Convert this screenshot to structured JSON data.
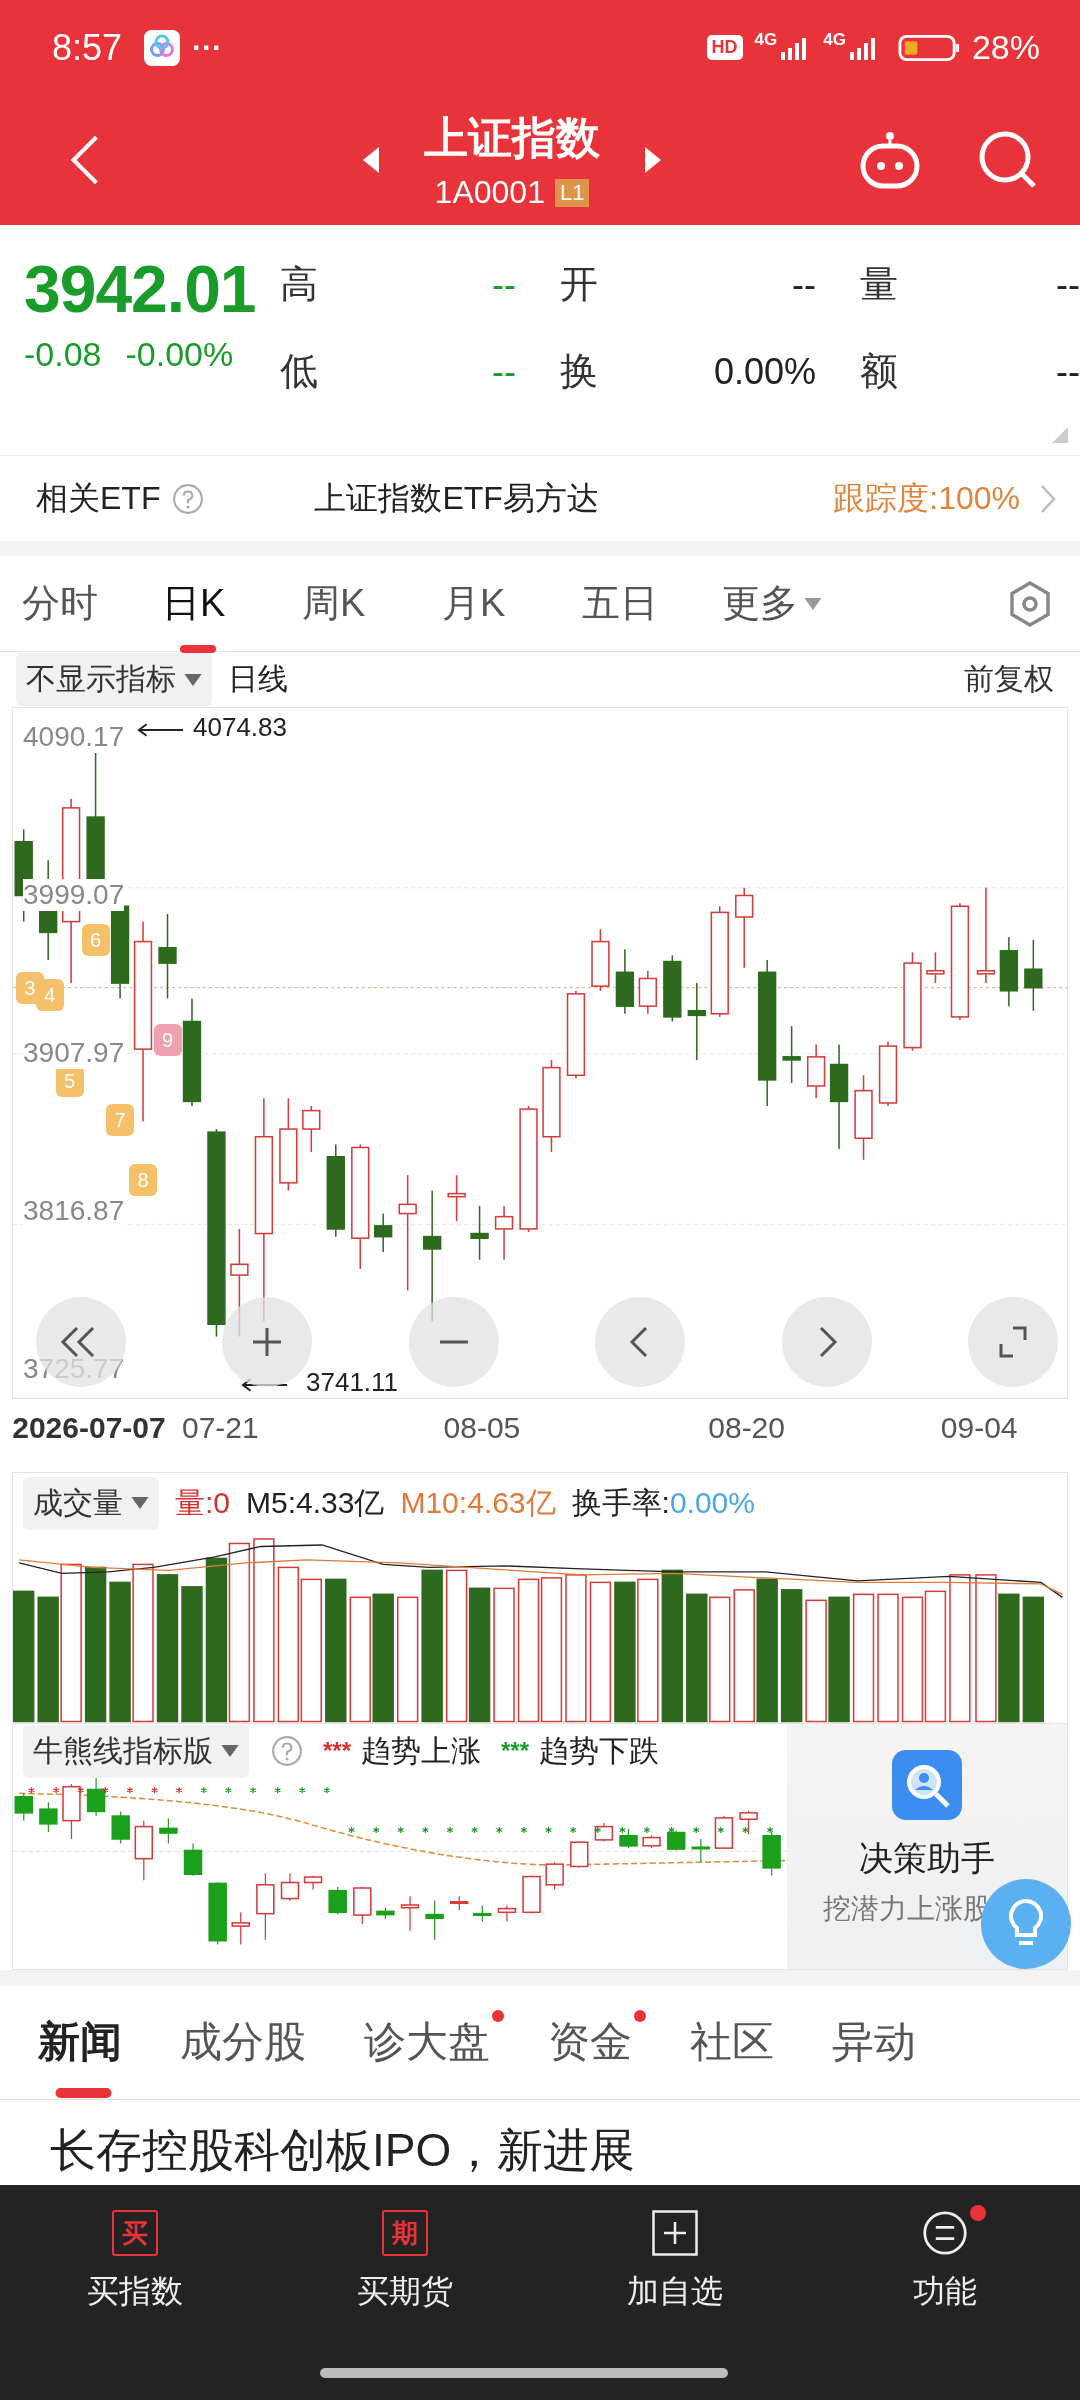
{
  "status_bar": {
    "time": "8:57",
    "more": "···",
    "hd": "HD",
    "network_1": "4G",
    "network_2": "4G",
    "battery": "28%"
  },
  "header": {
    "title": "上证指数",
    "code": "1A0001",
    "level_badge": "L1"
  },
  "quote": {
    "price": "3942.01",
    "change": "-0.08",
    "change_pct": "-0.00%",
    "fields": [
      {
        "label": "高",
        "value": "--",
        "color": "#1a9c2a"
      },
      {
        "label": "开",
        "value": "--",
        "color": "#222222"
      },
      {
        "label": "量",
        "value": "--",
        "color": "#222222"
      },
      {
        "label": "低",
        "value": "--",
        "color": "#1a9c2a"
      },
      {
        "label": "换",
        "value": "0.00%",
        "color": "#222222"
      },
      {
        "label": "额",
        "value": "--",
        "color": "#222222"
      }
    ]
  },
  "etf": {
    "label": "相关ETF",
    "name": "上证指数ETF易方达",
    "tracking": "跟踪度:100%"
  },
  "period_tabs": [
    {
      "label": "分时",
      "selected": false,
      "dropdown": false
    },
    {
      "label": "日K",
      "selected": true,
      "dropdown": false
    },
    {
      "label": "周K",
      "selected": false,
      "dropdown": false
    },
    {
      "label": "月K",
      "selected": false,
      "dropdown": false
    },
    {
      "label": "五日",
      "selected": false,
      "dropdown": false
    },
    {
      "label": "更多",
      "selected": false,
      "dropdown": true
    }
  ],
  "chart_toolbar": {
    "indicator": "不显示指标",
    "line_type": "日线",
    "adjust": "前复权"
  },
  "kline": {
    "y_labels": [
      "4090.17",
      "3999.07",
      "3907.97",
      "3816.87",
      "3725.77"
    ],
    "high_note": "4074.83",
    "low_note": "3741.11",
    "marks": [
      {
        "text": "3",
        "color": "#f5c06a"
      },
      {
        "text": "4",
        "color": "#f5c06a"
      },
      {
        "text": "5",
        "color": "#f5c06a"
      },
      {
        "text": "6",
        "color": "#f5c06a"
      },
      {
        "text": "7",
        "color": "#f5c06a"
      },
      {
        "text": "8",
        "color": "#f5c06a"
      },
      {
        "text": "9",
        "color": "#f2a0b0"
      }
    ],
    "x_labels": [
      "2026-07-07",
      "07-21",
      "08-05",
      "08-20",
      "09-04"
    ]
  },
  "volume": {
    "selector": "成交量",
    "vol_label": "量:",
    "vol_value": "0",
    "m5": "M5:4.33亿",
    "m10": "M10:4.63亿",
    "turnover_label": "换手率:",
    "turnover_value": "0.00%"
  },
  "bull_bear": {
    "selector": "牛熊线指标版",
    "legend": [
      {
        "mark": "***",
        "label": "趋势上涨",
        "color": "#d83030"
      },
      {
        "mark": "***",
        "label": "趋势下跌",
        "color": "#1a9c2a"
      }
    ]
  },
  "assistant": {
    "title": "决策助手",
    "subtitle": "挖潜力上涨股"
  },
  "news_tabs": [
    {
      "label": "新闻",
      "selected": true,
      "dot": false
    },
    {
      "label": "成分股",
      "selected": false,
      "dot": false
    },
    {
      "label": "诊大盘",
      "selected": false,
      "dot": true
    },
    {
      "label": "资金",
      "selected": false,
      "dot": true
    },
    {
      "label": "社区",
      "selected": false,
      "dot": false
    },
    {
      "label": "异动",
      "selected": false,
      "dot": false
    }
  ],
  "headline": "长存控股科创板IPO，新进展",
  "bottom_nav": [
    {
      "label": "买指数",
      "kind": "badge",
      "glyph": "买",
      "dot": false
    },
    {
      "label": "买期货",
      "kind": "badge",
      "glyph": "期",
      "dot": false
    },
    {
      "label": "加自选",
      "kind": "plus",
      "dot": false
    },
    {
      "label": "功能",
      "kind": "menu",
      "dot": true
    }
  ]
}
